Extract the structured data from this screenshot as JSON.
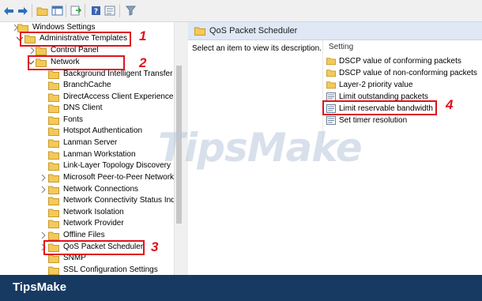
{
  "toolbar": {
    "icons": [
      "back-arrow-icon",
      "forward-arrow-icon",
      "folder-icon",
      "show-hide-tree-icon",
      "export-list-icon",
      "help-icon",
      "properties-icon",
      "filter-icon"
    ]
  },
  "tree": {
    "items": [
      {
        "label": "Windows Settings"
      },
      {
        "label": "Administrative Templates"
      },
      {
        "label": "Control Panel"
      },
      {
        "label": "Network"
      },
      {
        "label": "Background Intelligent Transfer S"
      },
      {
        "label": "BranchCache"
      },
      {
        "label": "DirectAccess Client Experience Se"
      },
      {
        "label": "DNS Client"
      },
      {
        "label": "Fonts"
      },
      {
        "label": "Hotspot Authentication"
      },
      {
        "label": "Lanman Server"
      },
      {
        "label": "Lanman Workstation"
      },
      {
        "label": "Link-Layer Topology Discovery"
      },
      {
        "label": "Microsoft Peer-to-Peer Networki"
      },
      {
        "label": "Network Connections"
      },
      {
        "label": "Network Connectivity Status Ind"
      },
      {
        "label": "Network Isolation"
      },
      {
        "label": "Network Provider"
      },
      {
        "label": "Offline Files"
      },
      {
        "label": "QoS Packet Scheduler"
      },
      {
        "label": "SNMP"
      },
      {
        "label": "SSL Configuration Settings"
      }
    ]
  },
  "right_pane": {
    "header_title": "QoS Packet Scheduler",
    "description": "Select an item to view its description.",
    "setting_header": "Setting",
    "settings": [
      {
        "label": "DSCP value of conforming packets",
        "icon": "folder-icon"
      },
      {
        "label": "DSCP value of non-conforming packets",
        "icon": "folder-icon"
      },
      {
        "label": "Layer-2 priority value",
        "icon": "folder-icon"
      },
      {
        "label": "Limit outstanding packets",
        "icon": "policy-setting-icon"
      },
      {
        "label": "Limit reservable bandwidth",
        "icon": "policy-setting-icon"
      },
      {
        "label": "Set timer resolution",
        "icon": "policy-setting-icon"
      }
    ]
  },
  "annotations": {
    "step1": "1",
    "step2": "2",
    "step3": "3",
    "step4": "4"
  },
  "watermark": "TipsMake",
  "footer": {
    "brand": "TipsMake"
  },
  "colors": {
    "highlight": "#e0121b",
    "footer": "#173a63",
    "folder": "#f3c95a",
    "header": "#dfe8f4"
  }
}
